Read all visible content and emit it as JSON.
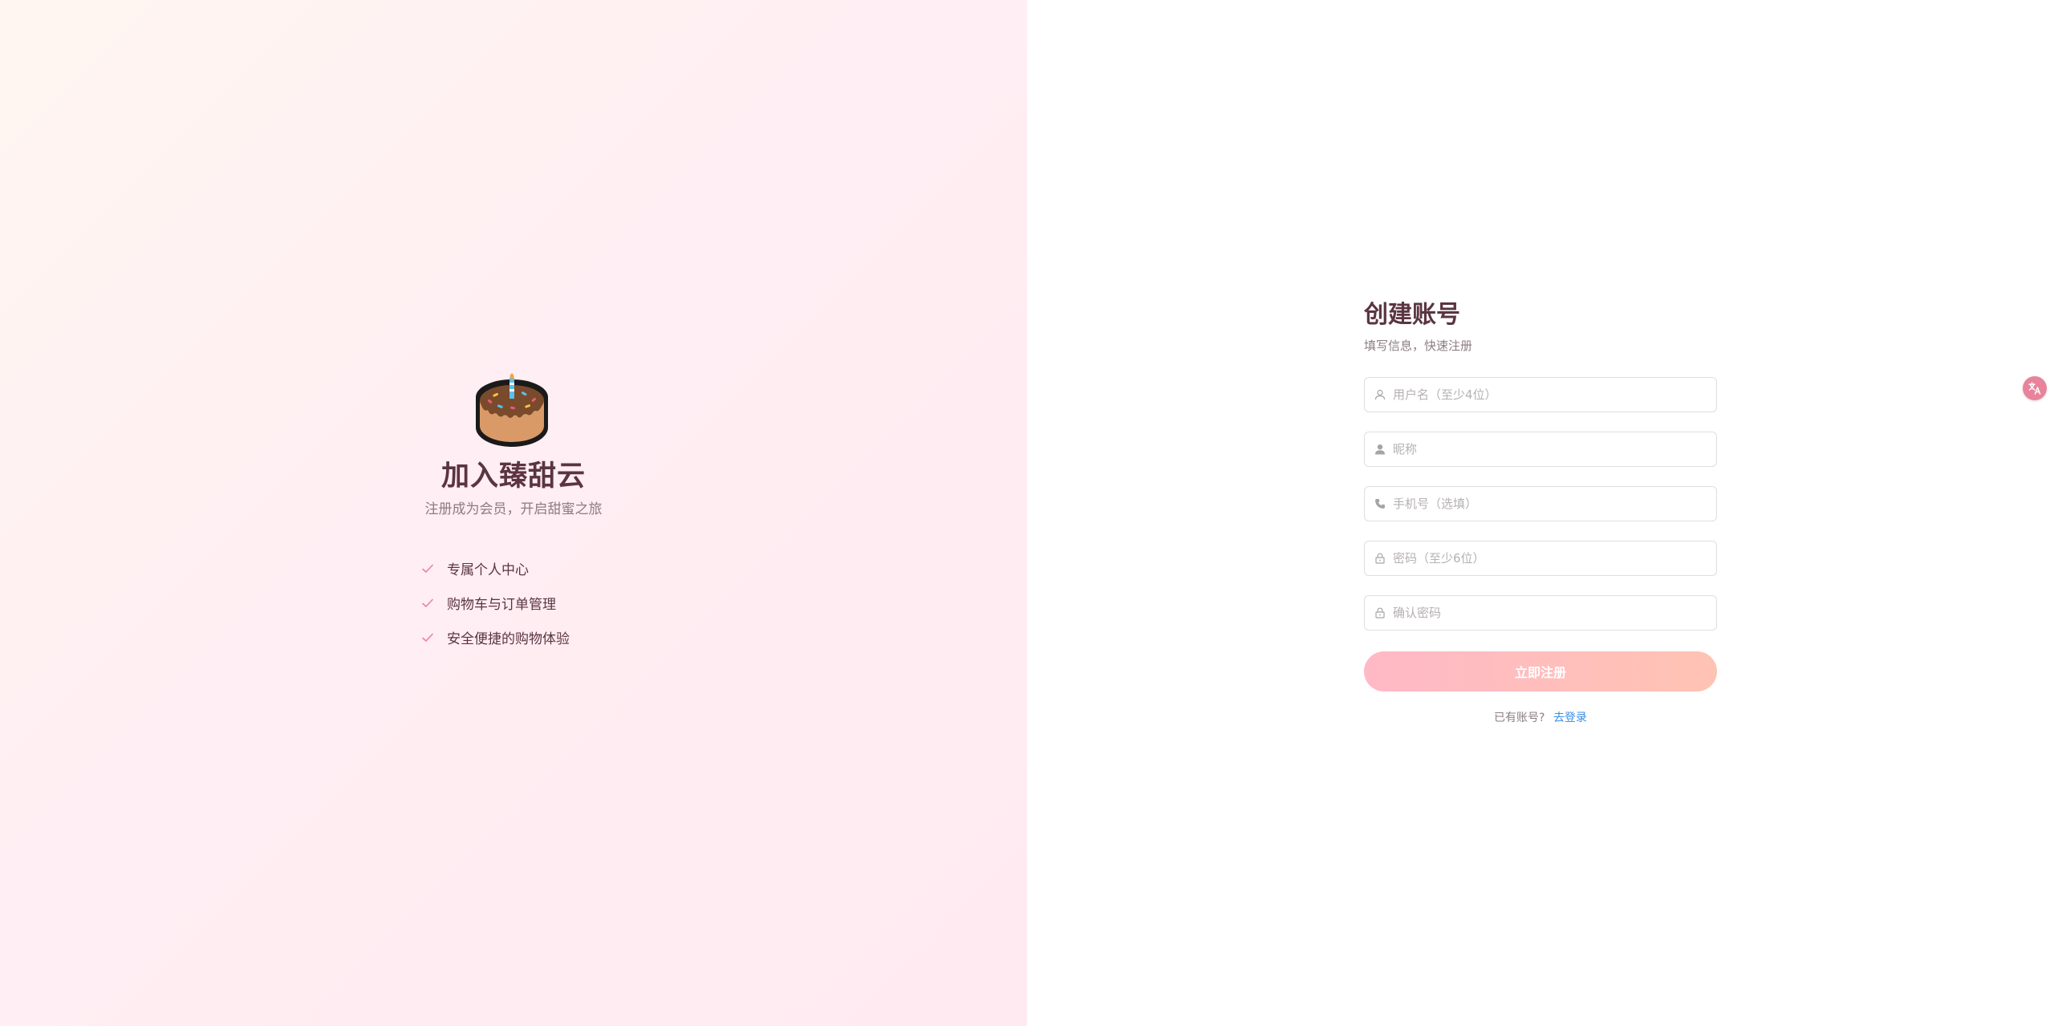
{
  "brand": {
    "title": "加入臻甜云",
    "subtitle": "注册成为会员，开启甜蜜之旅",
    "features": [
      {
        "label": "专属个人中心"
      },
      {
        "label": "购物车与订单管理"
      },
      {
        "label": "安全便捷的购物体验"
      }
    ],
    "logo_icon": "cake-icon",
    "check_icon": "check-icon",
    "colors": {
      "title": "#5b3442",
      "check": "#e8839b"
    }
  },
  "form": {
    "title": "创建账号",
    "subtitle": "填写信息，快速注册",
    "fields": [
      {
        "icon": "user-outline-icon",
        "placeholder": "用户名（至少4位）",
        "value": ""
      },
      {
        "icon": "user-filled-icon",
        "placeholder": "昵称",
        "value": ""
      },
      {
        "icon": "phone-icon",
        "placeholder": "手机号（选填）",
        "value": ""
      },
      {
        "icon": "lock-icon",
        "placeholder": "密码（至少6位）",
        "value": ""
      },
      {
        "icon": "lock-icon",
        "placeholder": "确认密码",
        "value": ""
      }
    ],
    "submit_label": "立即注册",
    "have_account_text": "已有账号?",
    "login_link_label": "去登录",
    "colors": {
      "button_start": "#ffb9c6",
      "button_end": "#ffc3b3",
      "link": "#3a8ee6"
    }
  },
  "widgets": {
    "translate_icon": "translate-icon"
  }
}
